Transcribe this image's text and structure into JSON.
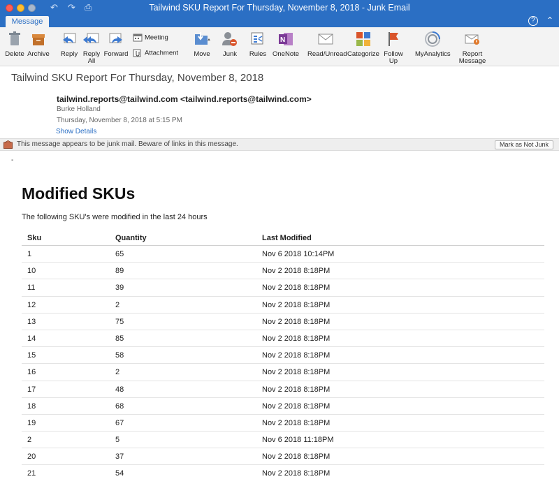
{
  "window": {
    "title": "Tailwind SKU Report For Thursday, November 8, 2018 - Junk Email"
  },
  "tabs": {
    "active": "Message",
    "help": "?"
  },
  "ribbon": {
    "delete": "Delete",
    "archive": "Archive",
    "reply": "Reply",
    "reply_all_1": "Reply",
    "reply_all_2": "All",
    "forward": "Forward",
    "meeting": "Meeting",
    "attachment": "Attachment",
    "move": "Move",
    "junk": "Junk",
    "rules": "Rules",
    "onenote": "OneNote",
    "read_unread": "Read/Unread",
    "categorize": "Categorize",
    "follow_up_1": "Follow",
    "follow_up_2": "Up",
    "myanalytics": "MyAnalytics",
    "report_message_1": "Report",
    "report_message_2": "Message"
  },
  "message": {
    "subject": "Tailwind SKU Report For Thursday, November 8, 2018",
    "sender": "tailwind.reports@tailwind.com <tailwind.reports@tailwind.com>",
    "recipient": "Burke Holland",
    "datetime": "Thursday, November 8, 2018 at 5:15 PM",
    "show_details": "Show Details"
  },
  "junk_bar": {
    "text": "This message appears to be junk mail. Beware of links in this message.",
    "button": "Mark as Not Junk"
  },
  "body": {
    "mark": "-",
    "heading": "Modified SKUs",
    "intro": "The following SKU's were modified in the last 24 hours",
    "columns": [
      "Sku",
      "Quantity",
      "Last Modified"
    ],
    "rows": [
      [
        "1",
        "65",
        "Nov 6 2018 10:14PM"
      ],
      [
        "10",
        "89",
        "Nov 2 2018 8:18PM"
      ],
      [
        "11",
        "39",
        "Nov 2 2018 8:18PM"
      ],
      [
        "12",
        "2",
        "Nov 2 2018 8:18PM"
      ],
      [
        "13",
        "75",
        "Nov 2 2018 8:18PM"
      ],
      [
        "14",
        "85",
        "Nov 2 2018 8:18PM"
      ],
      [
        "15",
        "58",
        "Nov 2 2018 8:18PM"
      ],
      [
        "16",
        "2",
        "Nov 2 2018 8:18PM"
      ],
      [
        "17",
        "48",
        "Nov 2 2018 8:18PM"
      ],
      [
        "18",
        "68",
        "Nov 2 2018 8:18PM"
      ],
      [
        "19",
        "67",
        "Nov 2 2018 8:18PM"
      ],
      [
        "2",
        "5",
        "Nov 6 2018 11:18PM"
      ],
      [
        "20",
        "37",
        "Nov 2 2018 8:18PM"
      ],
      [
        "21",
        "54",
        "Nov 2 2018 8:18PM"
      ]
    ]
  },
  "colors": {
    "accent": "#2b6fc4"
  }
}
